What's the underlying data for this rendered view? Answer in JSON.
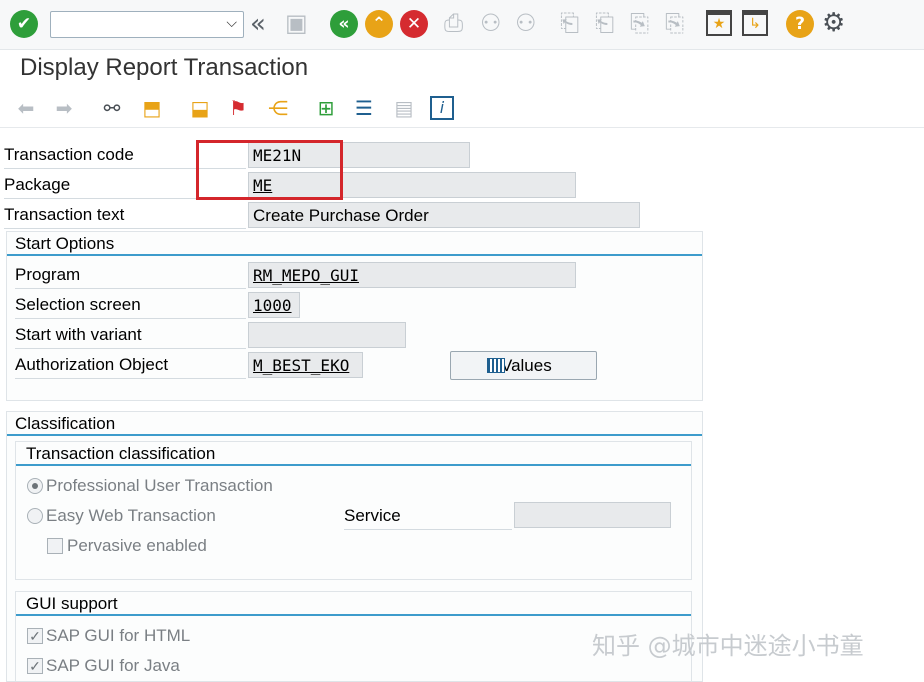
{
  "title": "Display Report Transaction",
  "systembar": {
    "command_field_value": "",
    "icons": [
      "enter-icon",
      "back-icon",
      "exit-icon",
      "cancel-icon",
      "print-icon",
      "find-icon",
      "first-page-icon",
      "last-page-icon"
    ]
  },
  "form": {
    "transaction_code_label": "Transaction code",
    "transaction_code_value": "ME21N",
    "package_label": "Package",
    "package_value": "ME",
    "transaction_text_label": "Transaction text",
    "transaction_text_value": "Create Purchase Order"
  },
  "start_options": {
    "title": "Start Options",
    "program_label": "Program",
    "program_value": "RM_MEPO_GUI",
    "selection_screen_label": "Selection screen",
    "selection_screen_value": "1000",
    "start_with_variant_label": "Start with variant",
    "start_with_variant_value": "",
    "authorization_object_label": "Authorization Object",
    "authorization_object_value": "M_BEST_EKO",
    "values_button_label": "Values"
  },
  "classification": {
    "title": "Classification",
    "transaction_classification_title": "Transaction classification",
    "professional_user_label": "Professional User Transaction",
    "easy_web_label": "Easy Web Transaction",
    "pervasive_label": "Pervasive enabled",
    "service_label": "Service",
    "service_value": ""
  },
  "gui_support": {
    "title": "GUI support",
    "html_label": "SAP GUI for HTML",
    "java_label": "SAP GUI for Java"
  },
  "watermark": "知乎 @城市中迷途小书童"
}
